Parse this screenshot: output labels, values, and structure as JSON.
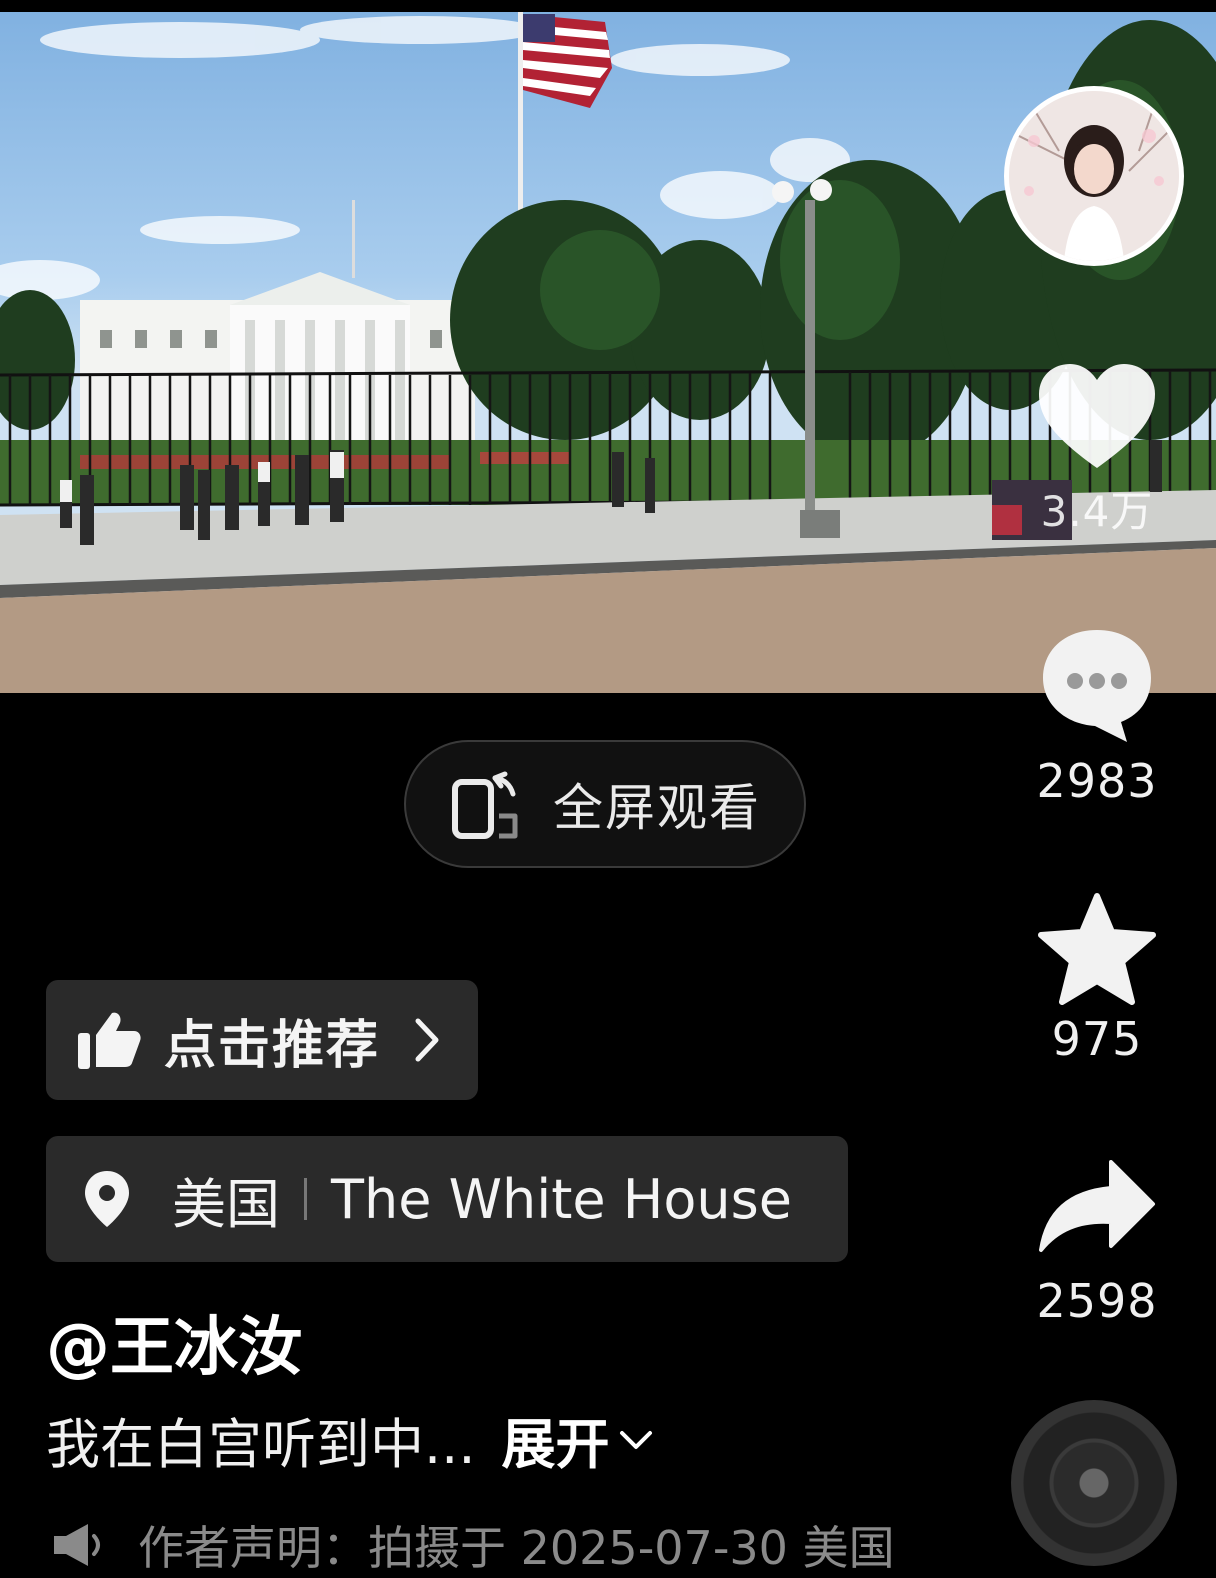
{
  "rail": {
    "like_count": "3.4万",
    "comment_count": "2983",
    "favorite_count": "975",
    "share_count": "2598"
  },
  "fullscreen": {
    "label": "全屏观看"
  },
  "recommend": {
    "label": "点击推荐"
  },
  "location": {
    "country": "美国",
    "place": "The White House"
  },
  "post": {
    "author": "@王冰汝",
    "caption": "我在白宫听到中...",
    "expand_label": "展开"
  },
  "statement": {
    "text": "作者声明：拍摄于 2025-07-30 美国"
  },
  "icons": {
    "like": "heart-icon",
    "comment": "comment-bubble-icon",
    "favorite": "star-icon",
    "share": "share-arrow-icon",
    "fullscreen": "rotate-phone-icon",
    "recommend": "thumbs-up-icon",
    "location": "location-pin-icon",
    "expand": "chevron-down-icon",
    "statement": "megaphone-icon",
    "music": "music-disc-icon"
  }
}
